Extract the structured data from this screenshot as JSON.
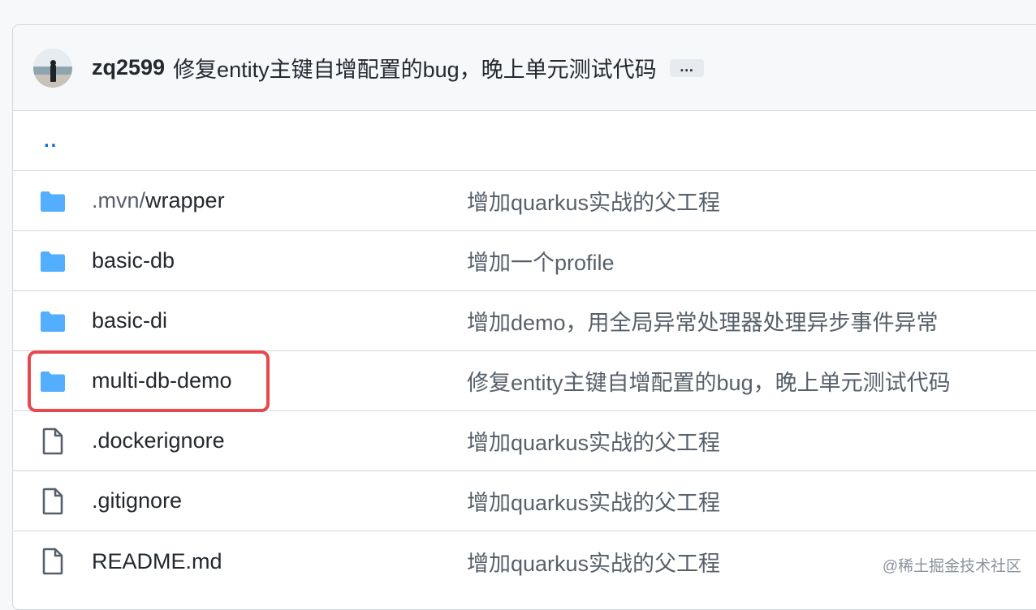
{
  "commit": {
    "author": "zq2599",
    "message": "修复entity主键自增配置的bug，晚上单元测试代码",
    "ellipsis": "…"
  },
  "parent_link": "..",
  "files": [
    {
      "type": "folder",
      "icon": "folder-icon",
      "name_dim": ".mvn/",
      "name": "wrapper",
      "message": "增加quarkus实战的父工程"
    },
    {
      "type": "folder",
      "icon": "folder-icon",
      "name_dim": "",
      "name": "basic-db",
      "message": "增加一个profile"
    },
    {
      "type": "folder",
      "icon": "folder-icon",
      "name_dim": "",
      "name": "basic-di",
      "message": "增加demo，用全局异常处理器处理异步事件异常"
    },
    {
      "type": "folder",
      "icon": "folder-icon",
      "name_dim": "",
      "name": "multi-db-demo",
      "message": "修复entity主键自增配置的bug，晚上单元测试代码"
    },
    {
      "type": "file",
      "icon": "file-icon",
      "name_dim": "",
      "name": ".dockerignore",
      "message": "增加quarkus实战的父工程"
    },
    {
      "type": "file",
      "icon": "file-icon",
      "name_dim": "",
      "name": ".gitignore",
      "message": "增加quarkus实战的父工程"
    },
    {
      "type": "file",
      "icon": "file-icon",
      "name_dim": "",
      "name": "README.md",
      "message": "增加quarkus实战的父工程"
    }
  ],
  "watermark": "@稀土掘金技术社区",
  "colors": {
    "folder": "#54aeff",
    "file": "#57606a",
    "highlight": "#e5484d",
    "link": "#0969da"
  }
}
